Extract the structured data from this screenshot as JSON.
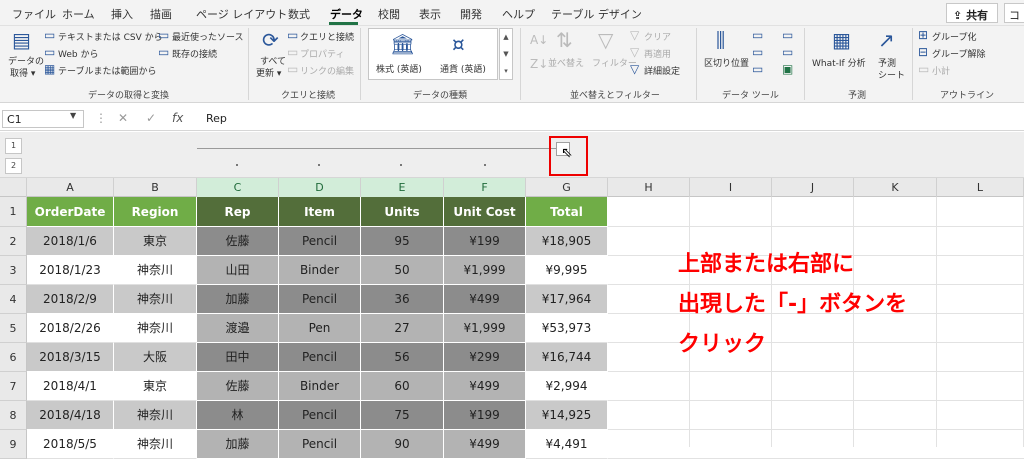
{
  "ribbon_tabs": [
    "ファイル",
    "ホーム",
    "挿入",
    "描画",
    "ページ レイアウト",
    "数式",
    "データ",
    "校閲",
    "表示",
    "開発",
    "ヘルプ",
    "テーブル デザイン"
  ],
  "share_label": "共有",
  "extra_tab": "コ",
  "get_data": {
    "line1": "データの",
    "line2": "取得 ▾",
    "text_csv": "テキストまたは CSV から",
    "web": "Web から",
    "table_range": "テーブルまたは範囲から",
    "recent": "最近使ったソース",
    "existing": "既存の接続",
    "group": "データの取得と変換"
  },
  "queries": {
    "refresh1": "すべて",
    "refresh2": "更新 ▾",
    "queries_conn": "クエリと接続",
    "properties": "プロパティ",
    "edit_links": "リンクの編集",
    "group": "クエリと接続"
  },
  "data_types": {
    "stocks": "株式 (英語)",
    "currency": "通貨 (英語)",
    "group": "データの種類"
  },
  "sort_filter": {
    "sort": "並べ替え",
    "filter": "フィルター",
    "clear": "クリア",
    "reapply": "再適用",
    "advanced": "詳細設定",
    "group": "並べ替えとフィルター"
  },
  "data_tools": {
    "text_to_columns": "区切り位置",
    "group": "データ ツール"
  },
  "forecast": {
    "whatif": "What-If 分析",
    "sheet1": "予測",
    "sheet2": "シート",
    "group": "予測"
  },
  "outline_grp": {
    "group_btn": "グループ化",
    "ungroup": "グループ解除",
    "subtotal": "小計",
    "group": "アウトライン"
  },
  "name_box": "C1",
  "formula_value": "Rep",
  "outline_levels": [
    "1",
    "2"
  ],
  "columns": [
    "A",
    "B",
    "C",
    "D",
    "E",
    "F",
    "G",
    "H",
    "I",
    "J",
    "K",
    "L"
  ],
  "rows": [
    "1",
    "2",
    "3",
    "4",
    "5",
    "6",
    "7",
    "8",
    "9"
  ],
  "table": {
    "headers": [
      "OrderDate",
      "Region",
      "Rep",
      "Item",
      "Units",
      "Unit Cost",
      "Total"
    ],
    "data": [
      [
        "2018/1/6",
        "東京",
        "佐藤",
        "Pencil",
        "95",
        "¥199",
        "¥18,905"
      ],
      [
        "2018/1/23",
        "神奈川",
        "山田",
        "Binder",
        "50",
        "¥1,999",
        "¥9,995"
      ],
      [
        "2018/2/9",
        "神奈川",
        "加藤",
        "Pencil",
        "36",
        "¥499",
        "¥17,964"
      ],
      [
        "2018/2/26",
        "神奈川",
        "渡邉",
        "Pen",
        "27",
        "¥1,999",
        "¥53,973"
      ],
      [
        "2018/3/15",
        "大阪",
        "田中",
        "Pencil",
        "56",
        "¥299",
        "¥16,744"
      ],
      [
        "2018/4/1",
        "東京",
        "佐藤",
        "Binder",
        "60",
        "¥499",
        "¥2,994"
      ],
      [
        "2018/4/18",
        "神奈川",
        "林",
        "Pencil",
        "75",
        "¥199",
        "¥14,925"
      ],
      [
        "2018/5/5",
        "神奈川",
        "加藤",
        "Pencil",
        "90",
        "¥499",
        "¥4,491"
      ]
    ]
  },
  "note_lines": [
    "上部または右部に",
    "出現した「-」ボタンを",
    "クリック"
  ],
  "colors": {
    "header_green": "#70ad47",
    "header_dark": "#536e3a",
    "band_gray": "#c9c9c9",
    "group_dark": "#8c8c8c",
    "group_light": "#b3b3b3",
    "note_red": "#ff0000",
    "accent": "#217346"
  }
}
